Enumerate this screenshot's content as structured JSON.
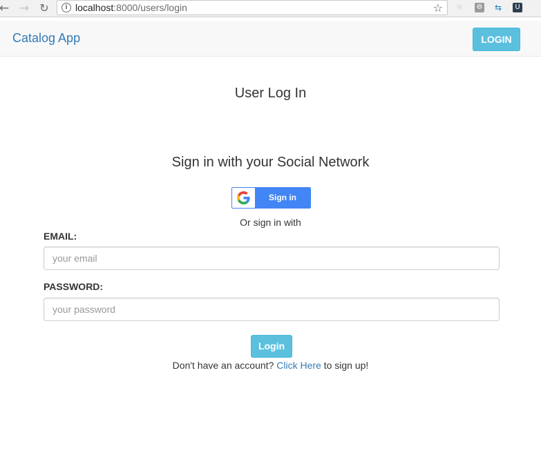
{
  "browser": {
    "back_icon": "back-arrow-icon",
    "forward_icon": "forward-arrow-icon",
    "reload_icon": "reload-icon",
    "url_host": "localhost",
    "url_path": ":8000/users/login",
    "star_icon": "bookmark-star-icon",
    "extensions": [
      "react-devtools-icon",
      "extension-icon",
      "arrows-extension-icon",
      "u-extension-icon"
    ]
  },
  "navbar": {
    "brand": "Catalog App",
    "login_button": "LOGIN"
  },
  "main": {
    "title": "User Log In",
    "social_heading": "Sign in with your Social Network",
    "google_button": "Sign in",
    "or_text": "Or sign in with",
    "email_label": "EMAIL:",
    "email_placeholder": "your email",
    "password_label": "PASSWORD:",
    "password_placeholder": "your password",
    "submit_button": "Login",
    "signup_prefix": "Don't have an account?",
    "signup_link": "Click Here",
    "signup_suffix": "to sign up!"
  },
  "colors": {
    "brand_link": "#337ab7",
    "info_button": "#5bc0de",
    "google_blue": "#4285f4"
  }
}
